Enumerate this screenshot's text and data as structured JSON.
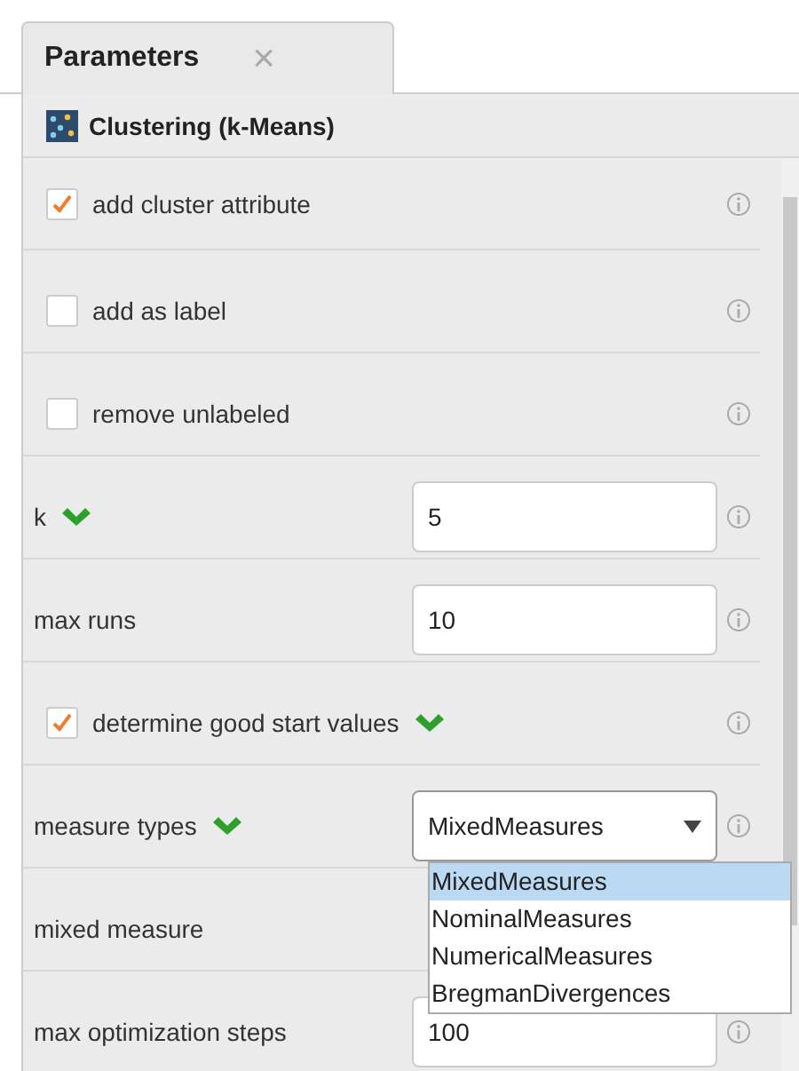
{
  "tab": {
    "label": "Parameters",
    "close": "×"
  },
  "operator": {
    "title": "Clustering (k-Means)"
  },
  "rows": [
    {
      "kind": "checkbox",
      "label": "add cluster attribute",
      "checked": true,
      "info": true,
      "flag": false
    },
    {
      "kind": "checkbox",
      "label": "add as label",
      "checked": false,
      "info": true,
      "flag": false
    },
    {
      "kind": "checkbox",
      "label": "remove unlabeled",
      "checked": false,
      "info": true,
      "flag": false
    },
    {
      "kind": "text",
      "label": "k",
      "value": "5",
      "info": true,
      "flag": true
    },
    {
      "kind": "text",
      "label": "max runs",
      "value": "10",
      "info": true,
      "flag": false
    },
    {
      "kind": "checkbox",
      "label": "determine good start values",
      "checked": true,
      "info": true,
      "flag": true
    },
    {
      "kind": "select",
      "label": "measure types",
      "value": "MixedMeasures",
      "info": true,
      "flag": true,
      "expanded": true,
      "options": [
        {
          "label": "MixedMeasures",
          "selected": true
        },
        {
          "label": "NominalMeasures",
          "selected": false
        },
        {
          "label": "NumericalMeasures",
          "selected": false
        },
        {
          "label": "BregmanDivergences",
          "selected": false
        }
      ]
    },
    {
      "kind": "plain",
      "label": "mixed measure",
      "info": false,
      "flag": false
    },
    {
      "kind": "text",
      "label": "max optimization steps",
      "value": "100",
      "info": true,
      "flag": false
    }
  ]
}
